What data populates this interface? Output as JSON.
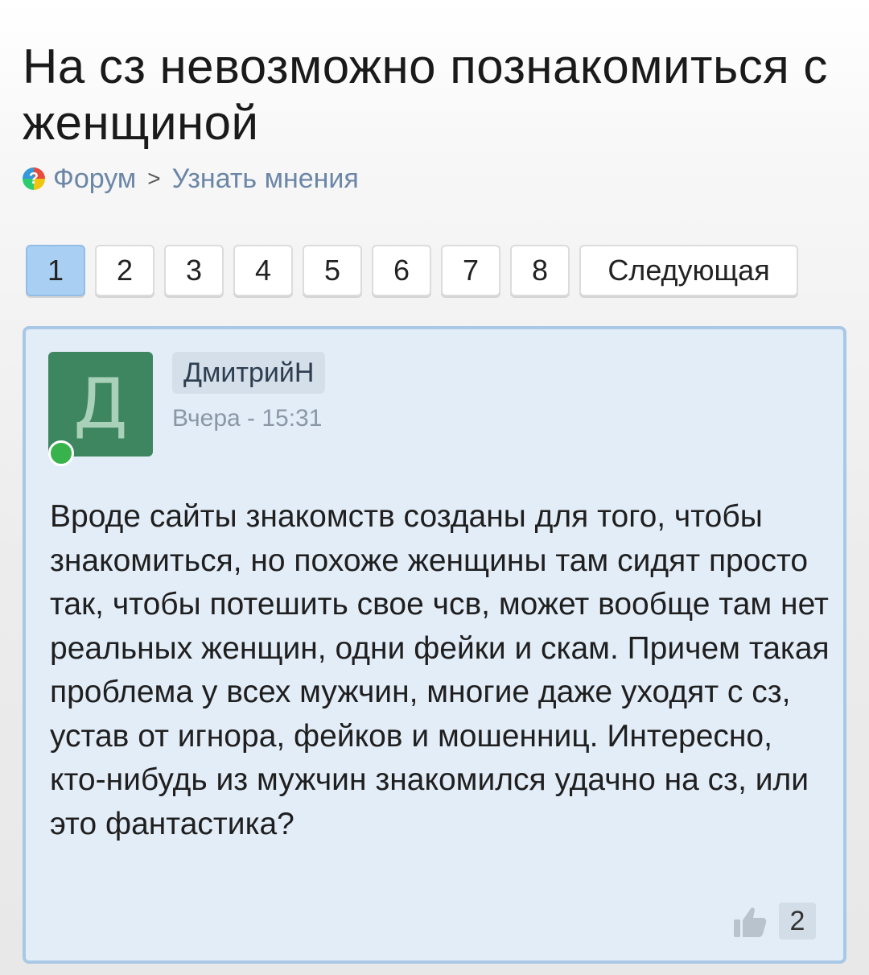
{
  "topic": {
    "title": "На сз невозможно познакомиться с женщиной"
  },
  "breadcrumb": {
    "icon": "question-circle-icon",
    "icon_glyph": "?",
    "forum_label": "Форум",
    "separator": ">",
    "section_label": "Узнать мнения"
  },
  "pagination": {
    "pages": [
      "1",
      "2",
      "3",
      "4",
      "5",
      "6",
      "7",
      "8"
    ],
    "current": "1",
    "next_label": "Следующая",
    "active_color": "#a9cff2"
  },
  "post": {
    "avatar_letter": "Д",
    "avatar_color": "#3e8660",
    "online_indicator_color": "#38b24a",
    "author": "ДмитрийН",
    "time": "Вчера - 15:31",
    "body": "Вроде сайты знакомств созданы для того, чтобы знакомиться, но похоже женщины там сидят просто так, чтобы потешить свое чсв, может вообще там нет реальных женщин, одни фейки и скам. Причем такая проблема у всех мужчин, многие даже уходят с сз, устав от игнора, фейков и мошенниц. Интересно, кто-нибудь из мужчин знакомился удачно на сз, или это фантастика?",
    "likes": "2",
    "like_icon": "thumbs-up-icon",
    "background_color": "#e3edf8",
    "border_color": "#a9c8e6"
  }
}
